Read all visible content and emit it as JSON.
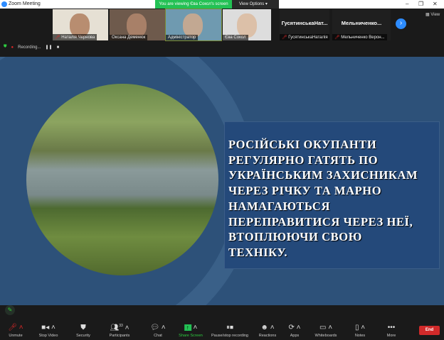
{
  "window": {
    "title": "Zoom Meeting",
    "banner": "You are viewing Єва Сокол's screen",
    "view_options": "View Options",
    "view": "View"
  },
  "participants_strip": [
    {
      "name": "Наталія Чернова",
      "muted": true
    },
    {
      "name": "Оксана Деменюк",
      "muted": false
    },
    {
      "name": "Адміністратор",
      "muted": false
    },
    {
      "name": "Єва Сокол",
      "muted": false
    },
    {
      "display": "ГусятинськаНат...",
      "name": "ГусятинськаНаталія",
      "muted": true
    },
    {
      "display": "Мельниченко...",
      "name": "Мельниченко Верон...",
      "muted": true
    }
  ],
  "recording": {
    "label": "Recording..."
  },
  "slide": {
    "lines": [
      "РОСІЙСЬКІ ОКУПАНТИ",
      "РЕГУЛЯРНО ГАТЯТЬ ПО",
      "УКРАЇНСЬКИМ ЗАХИСНИКАМ",
      "ЧЕРЕЗ РІЧКУ ТА МАРНО",
      "НАМАГАЮТЬСЯ",
      "ПЕРЕПРАВИТИСЯ ЧЕРЕЗ НЕЇ,",
      "ВТОПЛЮЮЧИ СВОЮ",
      "ТЕХНІКУ."
    ]
  },
  "toolbar": {
    "unmute": "Unmute",
    "stop_video": "Stop Video",
    "security": "Security",
    "participants": "Participants",
    "participants_count": "33",
    "chat": "Chat",
    "share_screen": "Share Screen",
    "pause_stop": "Pause/stop recording",
    "reactions": "Reactions",
    "apps": "Apps",
    "whiteboards": "Whiteboards",
    "notes": "Notes",
    "more": "More",
    "end": "End"
  }
}
